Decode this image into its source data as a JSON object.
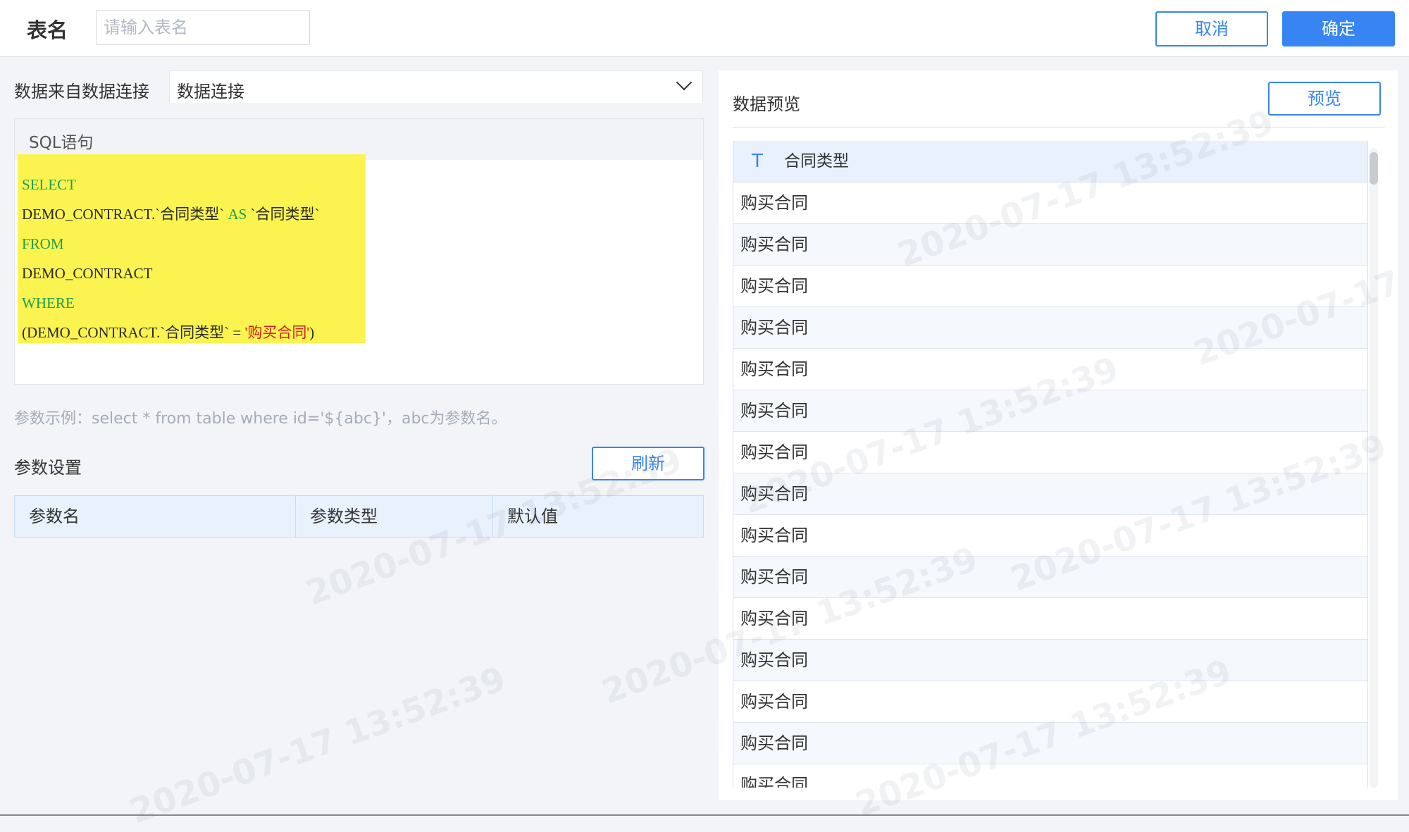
{
  "header": {
    "table_name_label": "表名",
    "table_name_placeholder": "请输入表名",
    "table_name_value": "",
    "cancel_label": "取消",
    "confirm_label": "确定"
  },
  "source": {
    "label": "数据来自数据连接",
    "selected": "数据连接"
  },
  "sql": {
    "header": "SQL语句",
    "lines": [
      [
        {
          "t": "SELECT",
          "c": "kw"
        }
      ],
      [
        {
          "t": "DEMO_CONTRACT.`合同类型` ",
          "c": "id"
        },
        {
          "t": "AS",
          "c": "kw"
        },
        {
          "t": " `合同类型`",
          "c": "id"
        }
      ],
      [
        {
          "t": "FROM",
          "c": "kw"
        }
      ],
      [
        {
          "t": "DEMO_CONTRACT",
          "c": "id"
        }
      ],
      [
        {
          "t": "WHERE",
          "c": "kw"
        }
      ],
      [
        {
          "t": "(DEMO_CONTRACT.`合同类型` = ",
          "c": "id"
        },
        {
          "t": "'购买合同'",
          "c": "str"
        },
        {
          "t": ")",
          "c": "id"
        }
      ]
    ]
  },
  "params": {
    "hint": "参数示例：select * from table where id='${abc}'，abc为参数名。",
    "title": "参数设置",
    "refresh_label": "刷新",
    "columns": [
      "参数名",
      "参数类型",
      "默认值"
    ]
  },
  "preview": {
    "title": "数据预览",
    "preview_label": "预览",
    "column_type_icon": "T",
    "column_name": "合同类型",
    "rows": [
      "购买合同",
      "购买合同",
      "购买合同",
      "购买合同",
      "购买合同",
      "购买合同",
      "购买合同",
      "购买合同",
      "购买合同",
      "购买合同",
      "购买合同",
      "购买合同",
      "购买合同",
      "购买合同",
      "购买合同"
    ]
  },
  "watermark": {
    "text": "2020-07-17 13:52:39"
  },
  "colors": {
    "accent": "#3685f2",
    "sql_highlight": "#fbf450",
    "keyword": "#1f9e4e",
    "string": "#d61f1f"
  }
}
